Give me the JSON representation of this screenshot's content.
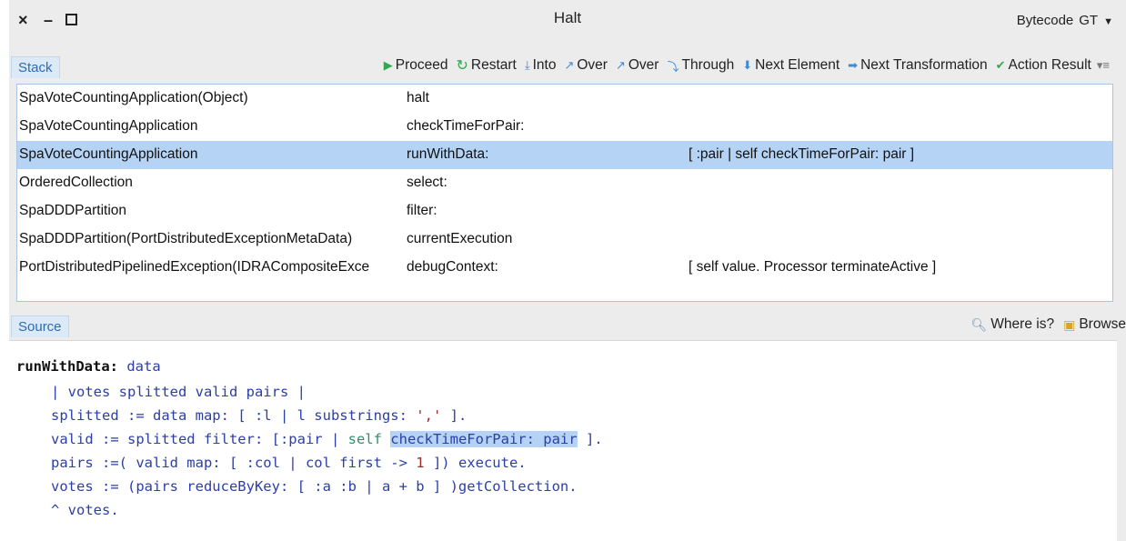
{
  "window": {
    "title": "Halt",
    "close_glyph": "×",
    "minimize_glyph": "–",
    "view_mode": "Bytecode",
    "view_mode2": "GT",
    "view_caret": "▼"
  },
  "stack_tab": "Stack",
  "source_tab": "Source",
  "toolbar": {
    "proceed": "Proceed",
    "restart": "Restart",
    "into": "Into",
    "over1": "Over",
    "over2": "Over",
    "through": "Through",
    "next_element": "Next Element",
    "next_transformation": "Next Transformation",
    "action_result": "Action Result",
    "menu_glyph": "▾≡"
  },
  "icons": {
    "proceed": "play-icon",
    "restart": "restart-icon",
    "into": "step-into-icon",
    "over": "step-over-icon",
    "through": "step-through-icon",
    "next_element": "down-arrow-icon",
    "next_transformation": "right-arrow-icon",
    "action_result": "checkmark-icon"
  },
  "stack": [
    {
      "receiver": "SpaVoteCountingApplication(Object)",
      "method": "halt",
      "block": ""
    },
    {
      "receiver": "SpaVoteCountingApplication",
      "method": "checkTimeForPair:",
      "block": ""
    },
    {
      "receiver": "SpaVoteCountingApplication",
      "method": "runWithData:",
      "block": "[ :pair | self checkTimeForPair: pair ]"
    },
    {
      "receiver": "OrderedCollection",
      "method": "select:",
      "block": ""
    },
    {
      "receiver": "SpaDDDPartition",
      "method": "filter:",
      "block": ""
    },
    {
      "receiver": "SpaDDDPartition(PortDistributedExceptionMetaData)",
      "method": "currentExecution",
      "block": ""
    },
    {
      "receiver": "PortDistributedPipelinedException(IDRACompositeExce",
      "method": "debugContext:",
      "block": "[ self value. Processor terminateActive ]"
    }
  ],
  "selected_row_index": 2,
  "source_tools": {
    "where_is": "Where is?",
    "browse": "Browse"
  },
  "code": {
    "l1_sel": "runWithData:",
    "l1_arg": "data",
    "l2": "| votes splitted valid pairs |",
    "l3_a": "splitted := data map: [ :l | l substrings: ",
    "l3_str": "','",
    "l3_b": " ].",
    "l4_a": "valid := splitted filter: [:pair | ",
    "l4_self": "self",
    "l4_hl": "checkTimeForPair: pair",
    "l4_b": " ].",
    "l5_a": "pairs :=( valid map: [ :col | col first -> ",
    "l5_num": "1",
    "l5_b": " ]) execute.",
    "l6": "votes := (pairs reduceByKey: [ :a :b | a + b ] )getCollection.",
    "l7": "^ votes."
  },
  "colors": {
    "selection": "#b5d3f5",
    "accent": "#2d6bb3",
    "green": "#33a852"
  }
}
